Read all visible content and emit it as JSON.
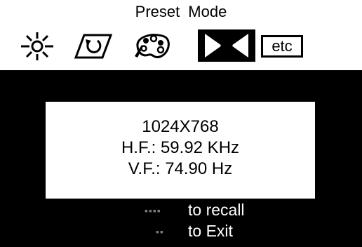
{
  "header": {
    "title_word_1": "Preset",
    "title_word_2": "Mode"
  },
  "icons": [
    {
      "name": "brightness-icon",
      "selected": false
    },
    {
      "name": "geometry-icon",
      "selected": false
    },
    {
      "name": "color-palette-icon",
      "selected": false
    },
    {
      "name": "preset-mode-icon",
      "selected": true
    },
    {
      "name": "etc",
      "label": "etc",
      "selected": false
    }
  ],
  "info": {
    "resolution": "1024X768",
    "hf": "H.F.: 59.92 KHz",
    "vf": "V.F.: 74.90  Hz"
  },
  "hints": {
    "recall_key": "▪▪▪▪",
    "recall_text": "to recall",
    "exit_key": "▪▪",
    "exit_text": "to Exit"
  },
  "colors": {
    "background": "#ffffff",
    "panel": "#000000",
    "text": "#000000",
    "hint_text": "#ffffff"
  }
}
